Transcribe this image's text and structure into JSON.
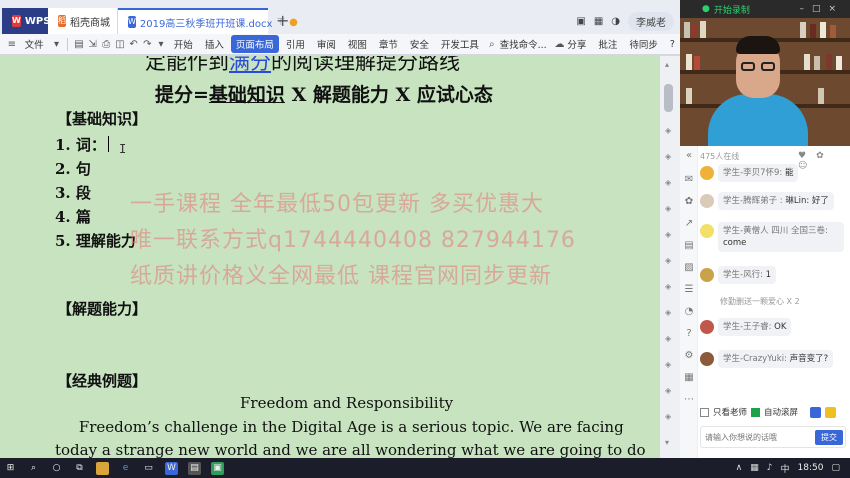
{
  "wps": {
    "tabs": {
      "app": "WPS",
      "store": "稻壳商城",
      "doc": "2019高三秋季班开班课.docx"
    },
    "user_chip": "李威老",
    "toolbar": {
      "file": "文件",
      "items": [
        "开始",
        "插入",
        "页面布局",
        "引用",
        "审阅",
        "视图",
        "章节",
        "安全",
        "开发工具"
      ],
      "search": "查找命令...",
      "share": "分享",
      "comment": "批注",
      "sync": "待同步",
      "help": "?"
    }
  },
  "doc": {
    "title1_a": "定能作到",
    "title1_b": "满分",
    "title1_c": "的阅读理解提分路线",
    "title2_a": "提分=",
    "title2_b": "基础知识",
    "title2_c": "X 解题能力 X 应试心态",
    "section_basic": "【基础知识】",
    "items": [
      "1.  词：",
      "2.  句",
      "3.  段",
      "4.  篇",
      "5.  理解能力"
    ],
    "section_solving": "【解题能力】",
    "section_examples": "【经典例题】",
    "essay_title": "Freedom and Responsibility",
    "para1": "Freedom’s challenge in the Digital Age is a serious topic. We are facing",
    "para2": "today a strange new world and we are all wondering what we are going to do",
    "watermarks": [
      "一手课程    全年最低50包更新  多买优惠大",
      "唯一联系方式q1744440408    827944176",
      "纸质讲价格义全网最低   课程官网同步更新"
    ]
  },
  "live": {
    "top_label": "开始录制",
    "online": "475人在线",
    "messages": [
      {
        "name": "学生-李贝7怀9:",
        "text": "能"
      },
      {
        "name": "学生-腾辉弟子 :",
        "text": "琳Lin: 好了"
      },
      {
        "name": "学生-黄僧人 四川 全国三卷:",
        "text": "come"
      },
      {
        "name": "学生-风行:",
        "text": "1"
      },
      {
        "name": "学生-王子睿:",
        "text": "OK"
      },
      {
        "name": "学生-CrazyYuki:",
        "text": "声音变了?"
      }
    ],
    "system_msg": "修勤删送一颗爱心 X 2",
    "filter_teacher": "只看老师",
    "filter_autoscroll": "自动滚屏",
    "input_placeholder": "请输入你想说的话哦",
    "send": "提交"
  },
  "taskbar": {
    "clock": "18:50"
  },
  "colors": {
    "doc_bg": "#c7e3c0",
    "accent": "#3a67d8",
    "watermark": "#e67878",
    "send_button": "#3a67d8"
  }
}
